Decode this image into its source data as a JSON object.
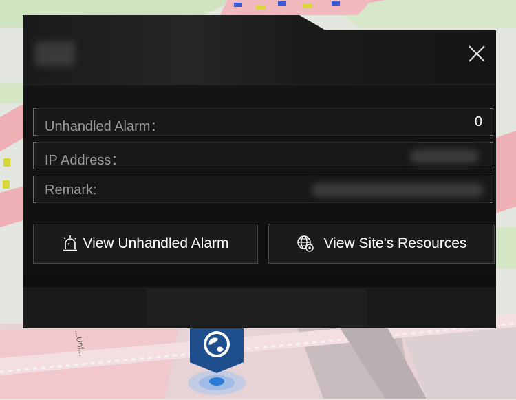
{
  "popup": {
    "title": "",
    "close_icon": "close-icon",
    "rows": [
      {
        "label": "Unhandled Alarm：",
        "value": "0"
      },
      {
        "label": "IP Address：",
        "value": ""
      },
      {
        "label": "Remark:",
        "value": ""
      }
    ],
    "buttons": [
      {
        "label": "View Unhandled Alarm",
        "icon": "alarm-icon"
      },
      {
        "label": "View Site's Resources",
        "icon": "globe-icon"
      }
    ]
  },
  "map": {
    "street_label": "...Unf...",
    "marker_icon": "globe-marker-icon"
  },
  "colors": {
    "panel": "#0f0f0f",
    "row_bg": "#181818",
    "label_text": "#9a9a9a",
    "value_text": "#ffffff",
    "marker": "#1f4e8c",
    "location_dot": "#2a7bd8"
  }
}
